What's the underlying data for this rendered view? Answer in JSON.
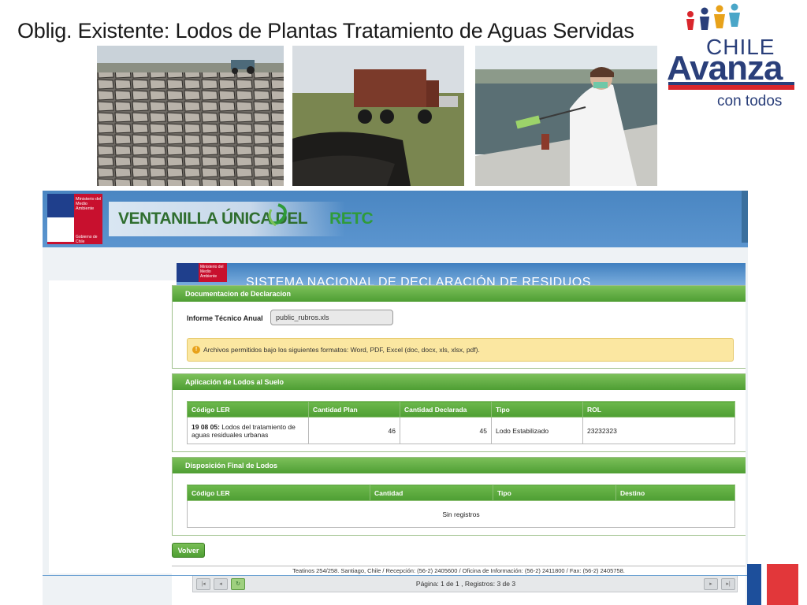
{
  "slide": {
    "title": "Oblig. Existente: Lodos de Plantas Tratamiento de Aguas Servidas"
  },
  "logo": {
    "line1": "CHILE",
    "line2": "Avanza",
    "line3": "con todos"
  },
  "photos": [
    {
      "icon": "cracked-dried-sludge-field-photo"
    },
    {
      "icon": "dump-truck-sludge-pile-photo"
    },
    {
      "icon": "lab-technician-sampling-tank-photo"
    }
  ],
  "portal": {
    "ministry": "Ministerio del Medio Ambiente",
    "government": "Gobierno de Chile",
    "brand_main": "VENTANILLA ÚNICA DEL",
    "brand_retc": "RETC",
    "system_title": "SISTEMA NACIONAL DE DECLARACIÓN DE RESIDUOS",
    "documentation": {
      "header": "Documentacion de Declaracion",
      "label": "Informe Técnico Anual",
      "file_value": "public_rubros.xls",
      "alert": "Archivos permitidos bajo los siguientes formatos: Word, PDF, Excel (doc, docx, xls, xlsx, pdf)."
    },
    "application": {
      "header": "Aplicación de Lodos al Suelo",
      "columns": [
        "Código LER",
        "Cantidad Plan",
        "Cantidad Declarada",
        "Tipo",
        "ROL"
      ],
      "rows": [
        {
          "code": "19 08 05:",
          "code_desc": "Lodos del tratamiento de aguas residuales urbanas",
          "plan": "46",
          "declared": "45",
          "type": "Lodo Estabilizado",
          "rol": "23232323"
        }
      ]
    },
    "final_disposal": {
      "header": "Disposición Final de Lodos",
      "columns": [
        "Código LER",
        "Cantidad",
        "Tipo",
        "Destino"
      ],
      "empty_text": "Sin registros"
    },
    "back_button": "Volver",
    "footer": "Teatinos 254/258. Santiago, Chile / Recepción: (56-2) 2405600 / Oficina de Información: (56-2) 2411800 / Fax: (56-2) 2405758.",
    "pager": {
      "info": "Página: 1 de 1 , Registros: 3 de 3"
    }
  },
  "colors": {
    "green_header": "#4e9e33",
    "portal_blue": "#5b95cf",
    "chile_red": "#e2373a",
    "chile_blue": "#1d4f9b"
  }
}
